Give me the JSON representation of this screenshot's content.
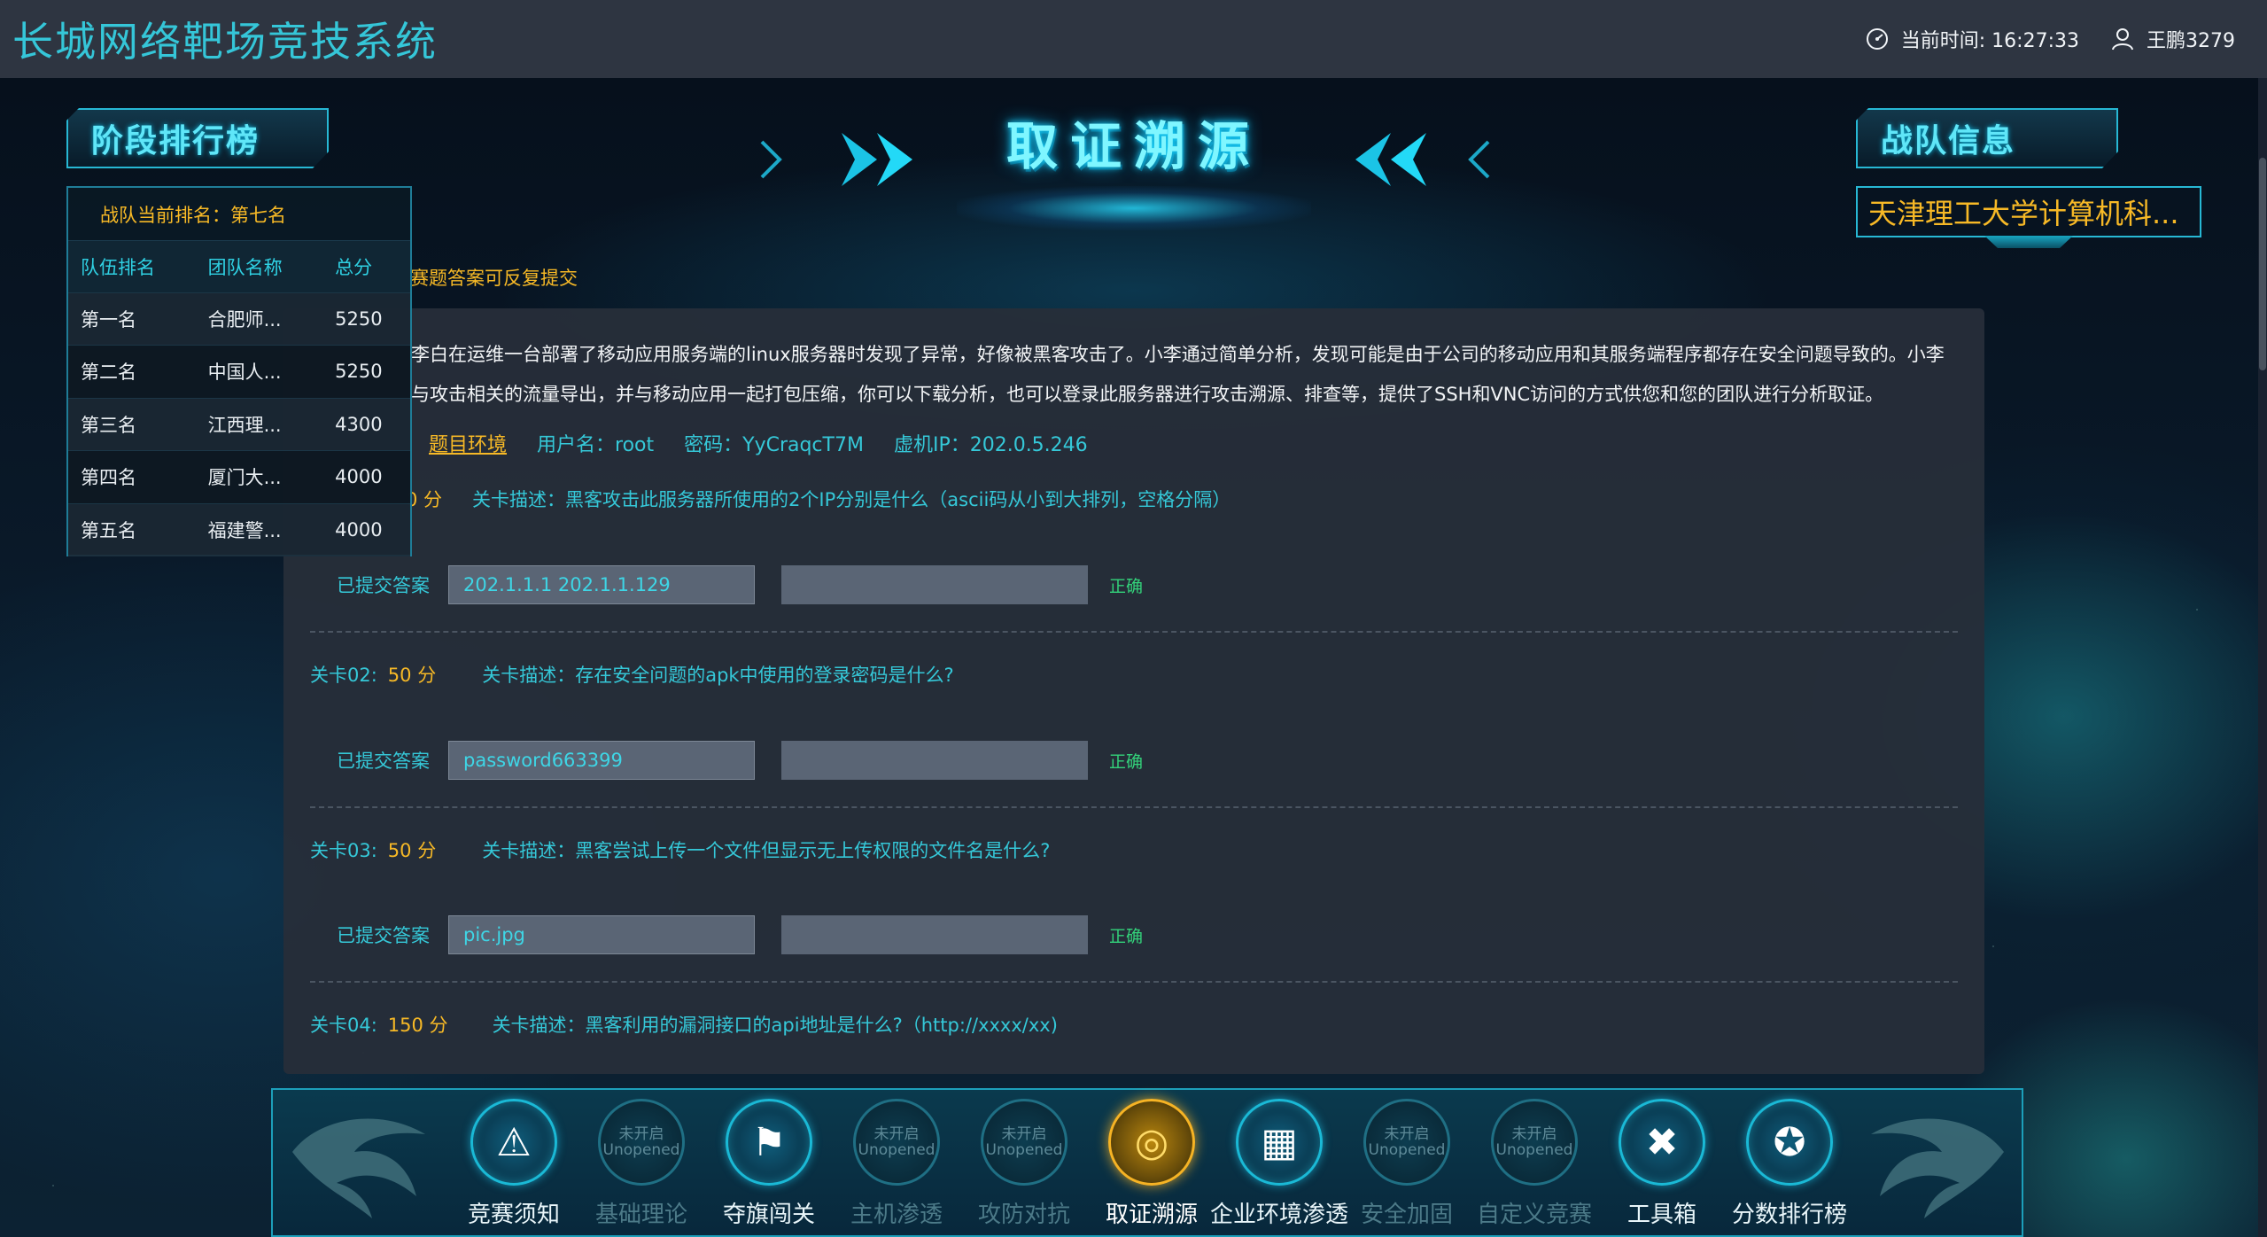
{
  "header": {
    "app_title": "长城网络靶场竞技系统",
    "time_label": "当前时间: 16:27:33",
    "user_name": "王鹏3279"
  },
  "banner": {
    "title": "取证溯源"
  },
  "leaderboard": {
    "tag": "阶段排行榜",
    "current_rank": "战队当前排名：第七名",
    "columns": [
      "队伍排名",
      "团队名称",
      "总分"
    ],
    "rows": [
      {
        "rank": "第一名",
        "team": "合肥师...",
        "score": "5250"
      },
      {
        "rank": "第二名",
        "team": "中国人...",
        "score": "5250"
      },
      {
        "rank": "第三名",
        "team": "江西理...",
        "score": "4300"
      },
      {
        "rank": "第四名",
        "team": "厦门大...",
        "score": "4000"
      },
      {
        "rank": "第五名",
        "team": "福建警...",
        "score": "4000"
      }
    ]
  },
  "team_info": {
    "tag": "战队信息",
    "team_name": "天津理工大学计算机科..."
  },
  "content": {
    "note": "赛题答案可反复提交",
    "description_line1": "李白在运维一台部署了移动应用服务端的linux服务器时发现了异常，好像被黑客攻击了。小李通过简单分析，发现可能是由于公司的移动应用和其服务端程序都存在安全问题导致的。小李",
    "description_line2": "与攻击相关的流量导出，并与移动应用一起打包压缩，你可以下载分析，也可以登录此服务器进行攻击溯源、排查等，提供了SSH和VNC访问的方式供您和您的团队进行分析取证。",
    "env_link": "题目环境",
    "username": "用户名：root",
    "password": "密码：YyCraqcT7M",
    "vm_ip": "虚机IP：202.0.5.246",
    "answer_label": "已提交答案",
    "levels": [
      {
        "head": "0 分",
        "score": "",
        "desc": "关卡描述：黑客攻击此服务器所使用的2个IP分别是什么（ascii码从小到大排列，空格分隔）",
        "answer": "202.1.1.1 202.1.1.129",
        "status": "正确"
      },
      {
        "head": "关卡02:",
        "score": "50 分",
        "desc": "关卡描述：存在安全问题的apk中使用的登录密码是什么?",
        "answer": "password663399",
        "status": "正确"
      },
      {
        "head": "关卡03:",
        "score": "50 分",
        "desc": "关卡描述：黑客尝试上传一个文件但显示无上传权限的文件名是什么?",
        "answer": "pic.jpg",
        "status": "正确"
      },
      {
        "head": "关卡04:",
        "score": "150 分",
        "desc": "关卡描述：黑客利用的漏洞接口的api地址是什么?（http://xxxx/xx)",
        "answer": "",
        "status": ""
      }
    ]
  },
  "nav": [
    {
      "label": "竞赛须知",
      "icon": "warning-icon",
      "glyph": "⚠",
      "state": "on"
    },
    {
      "label": "基础理论",
      "icon": "locked-icon",
      "glyph": "未开启 Unopened",
      "state": "off"
    },
    {
      "label": "夺旗闯关",
      "icon": "flag-icon",
      "glyph": "⚑",
      "state": "on"
    },
    {
      "label": "主机渗透",
      "icon": "locked-icon",
      "glyph": "未开启 Unopened",
      "state": "off"
    },
    {
      "label": "攻防对抗",
      "icon": "locked-icon",
      "glyph": "未开启 Unopened",
      "state": "off"
    },
    {
      "label": "取证溯源",
      "icon": "target-icon",
      "glyph": "◎",
      "state": "active"
    },
    {
      "label": "企业环境渗透",
      "icon": "building-icon",
      "glyph": "▦",
      "state": "on"
    },
    {
      "label": "安全加固",
      "icon": "locked-icon",
      "glyph": "未开启 Unopened",
      "state": "off"
    },
    {
      "label": "自定义竞赛",
      "icon": "locked-icon",
      "glyph": "未开启 Unopened",
      "state": "off"
    },
    {
      "label": "工具箱",
      "icon": "tools-icon",
      "glyph": "✖",
      "state": "on"
    },
    {
      "label": "分数排行榜",
      "icon": "medal-icon",
      "glyph": "✪",
      "state": "on"
    }
  ]
}
